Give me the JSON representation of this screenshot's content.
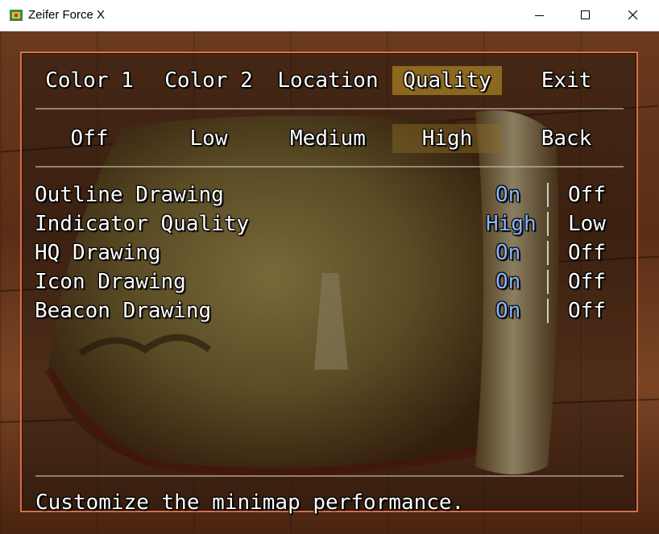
{
  "window": {
    "title": "Zeifer Force X",
    "icon": "game-app-icon",
    "controls": [
      "minimize-icon",
      "maximize-icon",
      "close-icon"
    ]
  },
  "menu": {
    "categories": [
      {
        "label": "Color 1"
      },
      {
        "label": "Color 2"
      },
      {
        "label": "Location"
      },
      {
        "label": "Quality"
      },
      {
        "label": "Exit"
      }
    ],
    "selected_category": "Quality",
    "presets": [
      {
        "label": "Off"
      },
      {
        "label": "Low"
      },
      {
        "label": "Medium"
      },
      {
        "label": "High"
      },
      {
        "label": "Back"
      }
    ],
    "selected_preset": "High",
    "options": [
      {
        "label": "Outline Drawing",
        "value_a": "On",
        "value_b": "Off",
        "active": "a"
      },
      {
        "label": "Indicator Quality",
        "value_a": "High",
        "value_b": "Low",
        "active": "a"
      },
      {
        "label": "HQ Drawing",
        "value_a": "On",
        "value_b": "Off",
        "active": "a"
      },
      {
        "label": "Icon Drawing",
        "value_a": "On",
        "value_b": "Off",
        "active": "a"
      },
      {
        "label": "Beacon Drawing",
        "value_a": "On",
        "value_b": "Off",
        "active": "a"
      }
    ],
    "help_text": "Customize the minimap performance.",
    "colors": {
      "active_value": "#8ab6ff",
      "border": "#d8704a",
      "highlight": "#c8a028"
    }
  }
}
